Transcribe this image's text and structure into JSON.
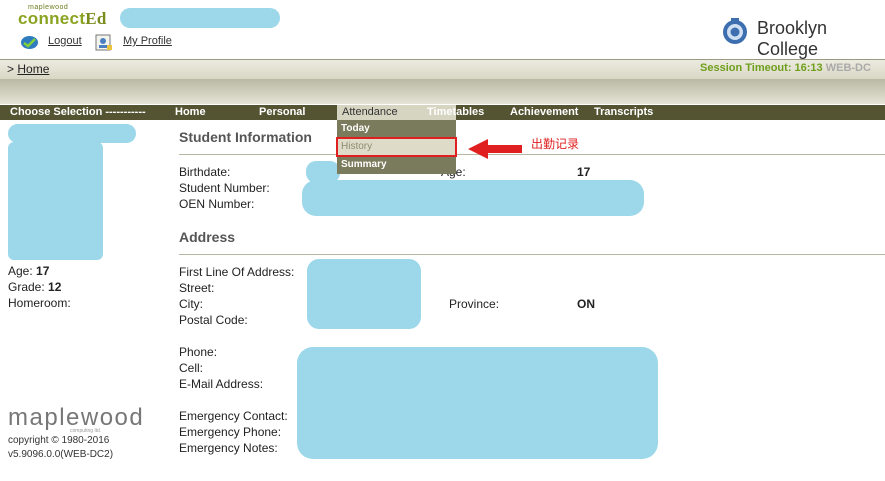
{
  "header": {
    "logo_small": "maplewood",
    "logo_main": "connect",
    "logo_ed": "Ed",
    "logout": "Logout",
    "my_profile": "My Profile",
    "college": "Brooklyn College"
  },
  "breadcrumb": {
    "prefix": ">",
    "home": "Home"
  },
  "session": {
    "label": "Session Timeout: 16:13",
    "server": "WEB-DC"
  },
  "nav": {
    "choose": "Choose Selection -----------",
    "home": "Home",
    "personal": "Personal",
    "attendance": "Attendance",
    "timetables": "Timetables",
    "achievement": "Achievement",
    "transcripts": "Transcripts"
  },
  "dropdown": {
    "today": "Today",
    "history": "History",
    "summary": "Summary"
  },
  "annotation": "出勤记录",
  "student_info": {
    "title": "Student Information",
    "birthdate_label": "Birthdate:",
    "student_number_label": "Student Number:",
    "oen_label": "OEN Number:",
    "age_label": "Age:",
    "age_value": "17"
  },
  "address": {
    "title": "Address",
    "first_line_label": "First Line Of Address:",
    "street_label": "Street:",
    "city_label": "City:",
    "postal_label": "Postal Code:",
    "province_label": "Province:",
    "province_value": "ON",
    "phone_label": "Phone:",
    "cell_label": "Cell:",
    "email_label": "E-Mail Address:",
    "emergency_contact_label": "Emergency Contact:",
    "emergency_phone_label": "Emergency Phone:",
    "emergency_notes_label": "Emergency Notes:"
  },
  "sidebar": {
    "age_label": "Age:",
    "age_value": "17",
    "grade_label": "Grade:",
    "grade_value": "12",
    "homeroom_label": "Homeroom:"
  },
  "footer": {
    "logo": "maplewood",
    "logo_sub": "computing ltd.",
    "copyright": "copyright © 1980-2016",
    "version": "v5.9096.0.0(WEB-DC2)"
  },
  "colors": {
    "nav_bar": "#545433",
    "session": "#6e9f1c",
    "annotation": "#e02020",
    "redaction": "#9cd8ea"
  }
}
